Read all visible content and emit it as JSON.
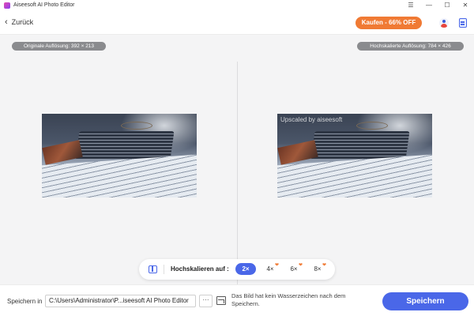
{
  "window": {
    "title": "Aiseesoft AI Photo Editor",
    "controls": {
      "menu": "☰",
      "minimize": "—",
      "maximize": "☐",
      "close": "✕"
    }
  },
  "header": {
    "back_label": "Zurück",
    "back_icon": "‹",
    "buy_button": "Kaufen - 66% OFF"
  },
  "workspace": {
    "original_resolution": "Originale Auflösung: 392 × 213",
    "upscaled_resolution": "Hochskalierte Auflösung: 784 × 426",
    "watermark": "Upscaled by aiseesoft"
  },
  "scale_bar": {
    "label": "Hochskalieren auf :",
    "options": [
      {
        "label": "2×",
        "active": true
      },
      {
        "label": "4×",
        "active": false
      },
      {
        "label": "6×",
        "active": false
      },
      {
        "label": "8×",
        "active": false
      }
    ],
    "heart_glyph": "❤"
  },
  "footer": {
    "save_in_label": "Speichern in",
    "save_path": "C:\\Users\\Administrator\\P...iseesoft AI Photo Editor",
    "more_button": "···",
    "hint": "Das Bild hat kein Wasserzeichen nach dem Speichern.",
    "save_button": "Speichern"
  },
  "colors": {
    "accent": "#4a67e8",
    "buy_orange": "#f07a34",
    "pill_gray": "#8a8b8e",
    "workspace_bg": "#f4f4f5"
  }
}
